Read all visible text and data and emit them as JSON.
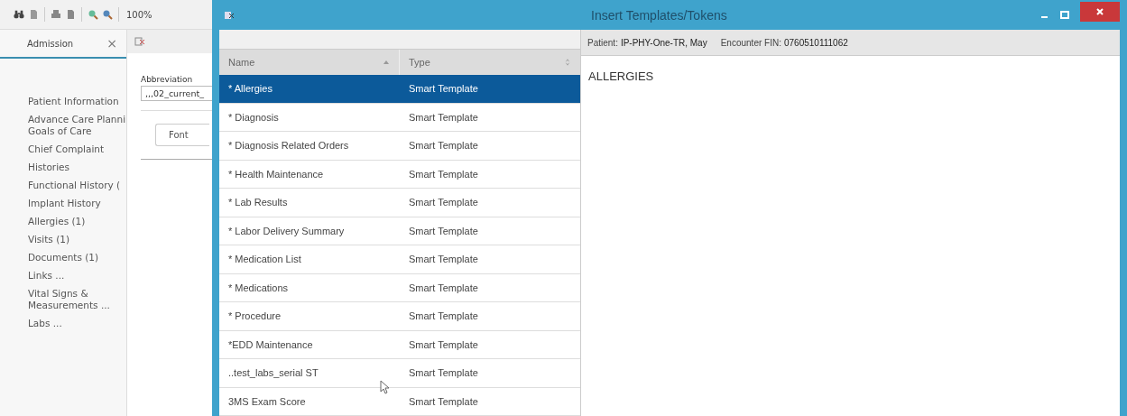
{
  "background_app": {
    "zoom": "100%",
    "tab": {
      "label": "Admission",
      "close": "×"
    },
    "sidebar": {
      "items": [
        "Patient Information",
        "Advance Care Planni\nGoals of Care",
        "Chief Complaint",
        "Histories",
        "Functional History (",
        "Implant History",
        "Allergies (1)",
        "Visits (1)",
        "Documents (1)",
        "Links ...",
        "Vital Signs &\nMeasurements ...",
        "Labs ..."
      ]
    },
    "inner_dialog": {
      "abbreviation_label": "Abbreviation",
      "abbreviation_value": ",,,02_current_",
      "font_button": "Font"
    }
  },
  "dialog": {
    "title": "Insert Templates/Tokens",
    "columns": [
      {
        "label": "Name",
        "sorted": true
      },
      {
        "label": "Type",
        "sorted": false
      }
    ],
    "rows": [
      {
        "name": "* Allergies",
        "type": "Smart Template",
        "selected": true
      },
      {
        "name": "* Diagnosis",
        "type": "Smart Template",
        "selected": false
      },
      {
        "name": "* Diagnosis Related Orders",
        "type": "Smart Template",
        "selected": false
      },
      {
        "name": "* Health Maintenance",
        "type": "Smart Template",
        "selected": false
      },
      {
        "name": "* Lab Results",
        "type": "Smart Template",
        "selected": false
      },
      {
        "name": "* Labor Delivery Summary",
        "type": "Smart Template",
        "selected": false
      },
      {
        "name": "* Medication List",
        "type": "Smart Template",
        "selected": false
      },
      {
        "name": "* Medications",
        "type": "Smart Template",
        "selected": false
      },
      {
        "name": "* Procedure",
        "type": "Smart Template",
        "selected": false
      },
      {
        "name": "*EDD Maintenance",
        "type": "Smart Template",
        "selected": false
      },
      {
        "name": "..test_labs_serial ST",
        "type": "Smart Template",
        "selected": false
      },
      {
        "name": "3MS Exam Score",
        "type": "Smart Template",
        "selected": false
      }
    ],
    "patient": {
      "label": "Patient:",
      "value": "IP-PHY-One-TR, May"
    },
    "encounter": {
      "label": "Encounter FIN:",
      "value": "0760510111062"
    },
    "preview": "ALLERGIES"
  }
}
